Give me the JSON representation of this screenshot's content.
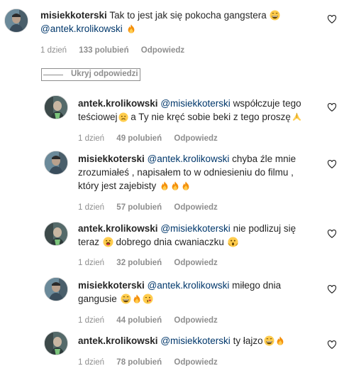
{
  "comment_main": {
    "username": "misiekkoterski",
    "text": "Tak to jest jak się pokocha gangstera",
    "mention": "@antek.krolikowski",
    "time": "1 dzień",
    "likes": "133 polubień",
    "reply": "Odpowiedz"
  },
  "hide_replies_label": "Ukryj odpowiedzi",
  "replies": [
    {
      "username": "antek.krolikowski",
      "mention": "@misiekkoterski",
      "text1": "współczuje tego",
      "text2": "teściowej",
      "text3": "a Ty nie kręć sobie beki z tego proszę",
      "time": "1 dzień",
      "likes": "49 polubień",
      "reply": "Odpowiedz"
    },
    {
      "username": "misiekkoterski",
      "mention": "@antek.krolikowski",
      "text1": "chyba źle mnie",
      "text2": "zrozumiałeś , napisałem to w odniesieniu do filmu ,",
      "text3": "który jest zajebisty",
      "time": "1 dzień",
      "likes": "57 polubień",
      "reply": "Odpowiedz"
    },
    {
      "username": "antek.krolikowski",
      "mention": "@misiekkoterski",
      "text1": "nie podlizuj się",
      "text2": "teraz",
      "text3": "dobrego dnia cwaniaczku",
      "time": "1 dzień",
      "likes": "32 polubień",
      "reply": "Odpowiedz"
    },
    {
      "username": "misiekkoterski",
      "mention": "@antek.krolikowski",
      "text1": "miłego dnia",
      "text2": "gangusie",
      "time": "1 dzień",
      "likes": "44 polubień",
      "reply": "Odpowiedz"
    },
    {
      "username": "antek.krolikowski",
      "mention": "@misiekkoterski",
      "text1": "ty łajzo",
      "time": "1 dzień",
      "likes": "78 polubień",
      "reply": "Odpowiedz"
    }
  ],
  "icons": {
    "heart": "heart-outline-icon",
    "fire": "fire-emoji",
    "grin": "grinning-emoji",
    "sad": "sad-face-emoji",
    "pray": "folded-hands-emoji",
    "tongue": "tongue-out-emoji",
    "scream": "screaming-face-emoji",
    "kiss": "kiss-emoji"
  },
  "colors": {
    "text": "#262626",
    "mention": "#00376b",
    "meta": "#8e8e8e",
    "border": "#dbdbdb"
  }
}
